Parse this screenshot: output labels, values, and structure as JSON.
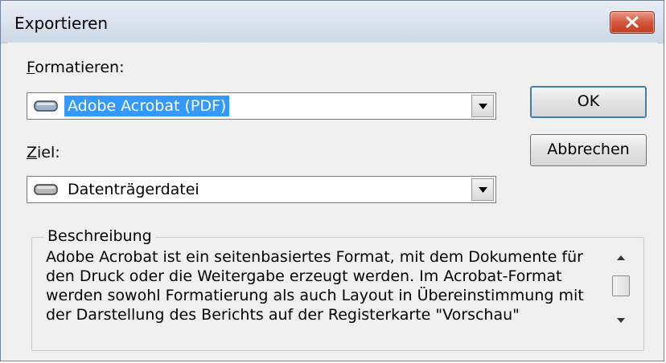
{
  "window": {
    "title": "Exportieren"
  },
  "format": {
    "label_prefix": "",
    "label_mnemonic": "F",
    "label_rest": "ormatieren:",
    "selected": "Adobe Acrobat (PDF)",
    "icon": "drive-icon"
  },
  "target": {
    "label_mnemonic": "Z",
    "label_rest": "iel:",
    "selected": "Datenträgerdatei",
    "icon": "drive-icon"
  },
  "buttons": {
    "ok": "OK",
    "cancel": "Abbrechen"
  },
  "description": {
    "title": "Beschreibung",
    "lines": [
      "Adobe Acrobat ist ein seitenbasiertes Format, mit dem Dokumente für",
      "den Druck oder die Weitergabe erzeugt werden. Im Acrobat-Format",
      "werden sowohl Formatierung als auch Layout in Übereinstimmung mit",
      "der Darstellung des Berichts auf der Registerkarte \"Vorschau\""
    ]
  },
  "colors": {
    "selection": "#3399ff",
    "close_button": "#c8472c"
  }
}
